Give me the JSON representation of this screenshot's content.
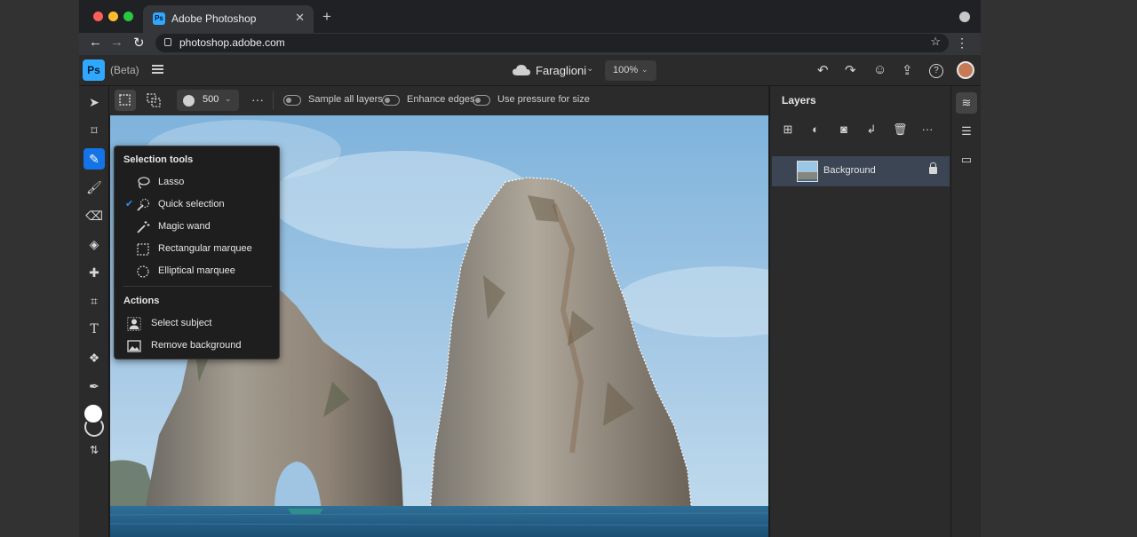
{
  "browser": {
    "tab_title": "Adobe Photoshop",
    "tab_favicon": "Ps",
    "url": "photoshop.adobe.com"
  },
  "app": {
    "logo": "Ps",
    "beta_label": "(Beta)",
    "doc_name": "Faraglioni",
    "zoom": "100%"
  },
  "options": {
    "brush_size": "500",
    "sample_all_layers": "Sample all layers",
    "enhance_edges": "Enhance edges",
    "use_pressure": "Use pressure for size"
  },
  "flyout": {
    "selection_heading": "Selection tools",
    "items": [
      {
        "label": "Lasso",
        "icon": "lasso-icon",
        "checked": false
      },
      {
        "label": "Quick selection",
        "icon": "quick-selection-icon",
        "checked": true
      },
      {
        "label": "Magic wand",
        "icon": "magic-wand-icon",
        "checked": false
      },
      {
        "label": "Rectangular marquee",
        "icon": "rectangular-marquee-icon",
        "checked": false
      },
      {
        "label": "Elliptical marquee",
        "icon": "elliptical-marquee-icon",
        "checked": false
      }
    ],
    "actions_heading": "Actions",
    "actions": [
      {
        "label": "Select subject",
        "icon": "person-icon"
      },
      {
        "label": "Remove background",
        "icon": "image-icon"
      }
    ]
  },
  "layers": {
    "title": "Layers",
    "items": [
      {
        "name": "Background",
        "locked": true
      }
    ]
  },
  "colors": {
    "accent": "#1473e6",
    "ps_blue": "#31a8ff",
    "panel_bg": "#2b2b2b",
    "selected_layer": "#3b4554"
  }
}
